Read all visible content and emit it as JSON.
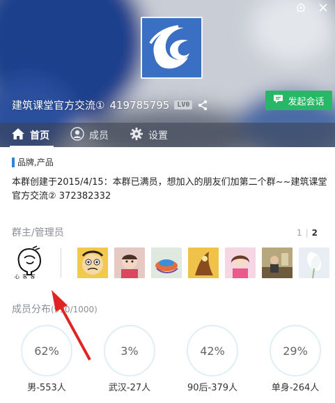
{
  "window": {
    "controls": [
      "skin-icon",
      "close-icon"
    ]
  },
  "header": {
    "group_name": "建筑课堂官方交流①",
    "group_id": "419785795",
    "level_badge": "LV0",
    "start_chat_label": "发起会话"
  },
  "tabs": [
    {
      "label": "首页",
      "icon": "home-icon",
      "active": true
    },
    {
      "label": "成员",
      "icon": "member-icon",
      "active": false
    },
    {
      "label": "设置",
      "icon": "gear-icon",
      "active": false
    }
  ],
  "main": {
    "category": "品牌,产品",
    "intro": "本群创建于2015/4/15：本群已满员，想加入的朋友们加第二个群~~建筑课堂官方交流② 372382332",
    "admins_title": "群主/管理员",
    "pager": {
      "pages": [
        "1",
        "2"
      ],
      "current": "2"
    },
    "owner_avatar_text": "心 客 客",
    "distribution_title": "成员分布",
    "distribution_count": "(990/1000)",
    "stats": [
      {
        "value": "62%",
        "label": "男-553人"
      },
      {
        "value": "3%",
        "label": "武汉-27人"
      },
      {
        "value": "42%",
        "label": "90后-379人"
      },
      {
        "value": "29%",
        "label": "单身-264人"
      }
    ]
  },
  "colors": {
    "accent_green": "#26b866",
    "category_blue": "#2f86d8",
    "logo_blue": "#3a6fc3",
    "annotation_red": "#e02424"
  }
}
